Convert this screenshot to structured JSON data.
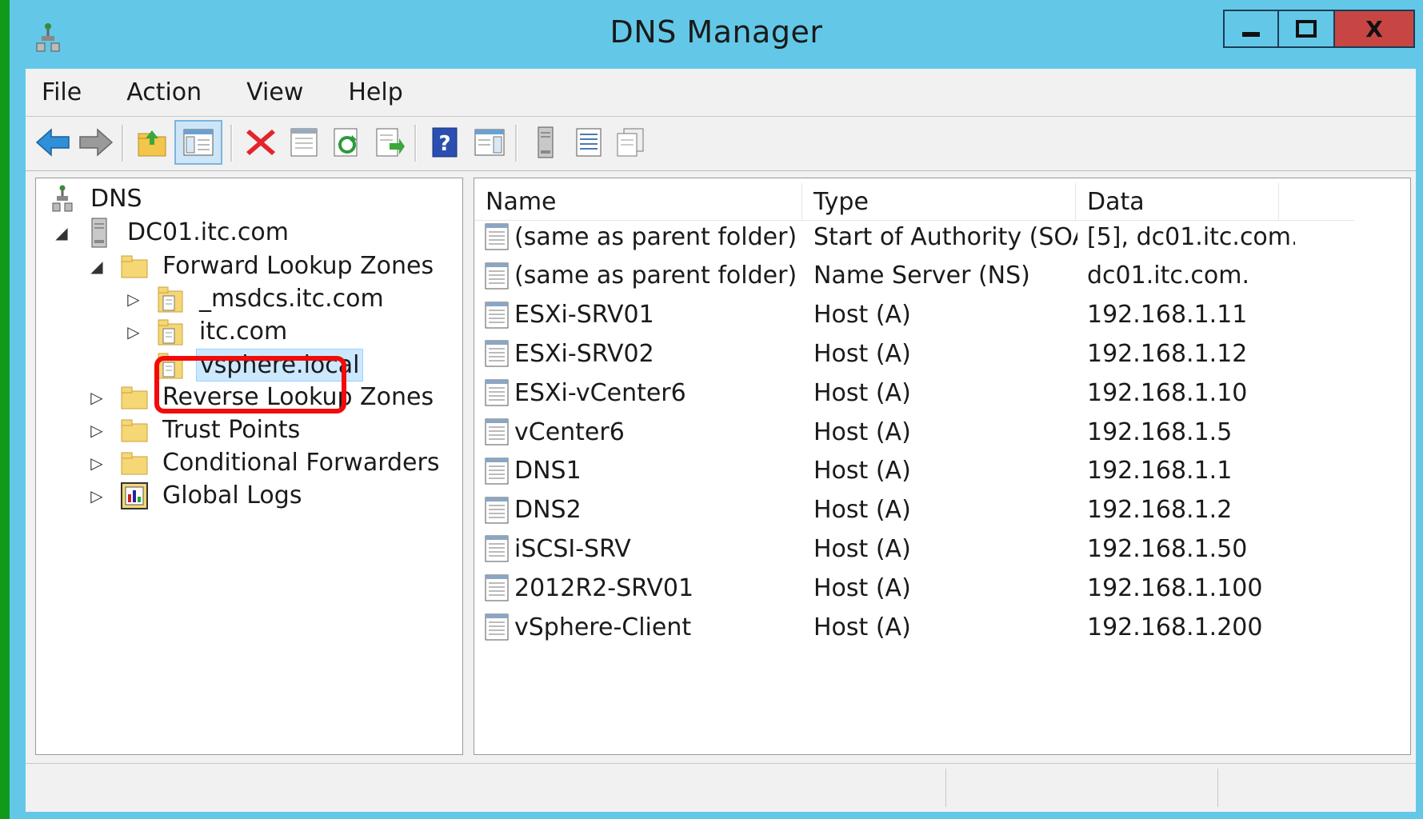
{
  "window": {
    "title": "DNS Manager",
    "buttons": {
      "minimize": "minimize",
      "maximize": "maximize",
      "close": "X"
    }
  },
  "menu": [
    "File",
    "Action",
    "View",
    "Help"
  ],
  "toolbar": [
    "back-arrow-icon",
    "forward-arrow-icon",
    "up-folder-icon",
    "show-hide-console-tree-icon",
    "delete-icon",
    "properties-icon",
    "refresh-icon",
    "export-list-icon",
    "help-icon",
    "show-hide-action-pane-icon",
    "server-icon",
    "list-view-icon",
    "copy-record-icon"
  ],
  "tree": {
    "root": "DNS",
    "server": "DC01.itc.com",
    "forward_zones": "Forward Lookup Zones",
    "zone1": "_msdcs.itc.com",
    "zone2": "itc.com",
    "zone3": "vsphere.local",
    "reverse_zones": "Reverse Lookup Zones",
    "trust_points": "Trust Points",
    "conditional_forwarders": "Conditional Forwarders",
    "global_logs": "Global Logs"
  },
  "list": {
    "columns": [
      "Name",
      "Type",
      "Data"
    ],
    "rows": [
      {
        "name": "(same as parent folder)",
        "type": "Start of Authority (SOA)",
        "data": "[5], dc01.itc.com..."
      },
      {
        "name": "(same as parent folder)",
        "type": "Name Server (NS)",
        "data": "dc01.itc.com."
      },
      {
        "name": "ESXi-SRV01",
        "type": "Host (A)",
        "data": "192.168.1.11"
      },
      {
        "name": "ESXi-SRV02",
        "type": "Host (A)",
        "data": "192.168.1.12"
      },
      {
        "name": "ESXi-vCenter6",
        "type": "Host (A)",
        "data": "192.168.1.10"
      },
      {
        "name": "vCenter6",
        "type": "Host (A)",
        "data": "192.168.1.5"
      },
      {
        "name": "DNS1",
        "type": "Host (A)",
        "data": "192.168.1.1"
      },
      {
        "name": "DNS2",
        "type": "Host (A)",
        "data": "192.168.1.2"
      },
      {
        "name": "iSCSI-SRV",
        "type": "Host (A)",
        "data": "192.168.1.50"
      },
      {
        "name": "2012R2-SRV01",
        "type": "Host (A)",
        "data": "192.168.1.100"
      },
      {
        "name": "vSphere-Client",
        "type": "Host (A)",
        "data": "192.168.1.200"
      }
    ]
  },
  "colors": {
    "titlebar": "#63c8e8",
    "close": "#c74644",
    "highlight": "#f30b0b",
    "background": "#0f9a1c"
  }
}
